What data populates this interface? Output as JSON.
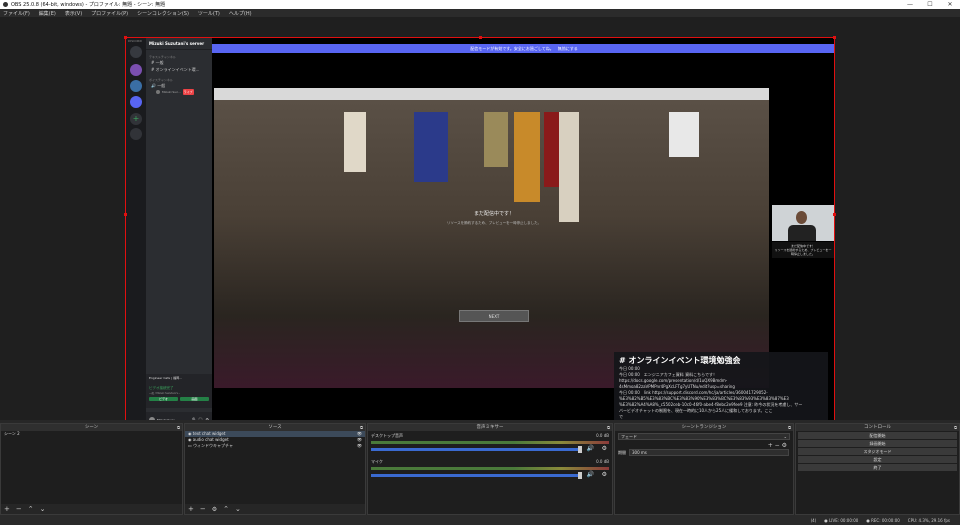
{
  "titlebar": {
    "title": "OBS 25.0.8 (64-bit, windows) - プロファイル: 無題 - シーン: 無題",
    "minimize": "—",
    "maximize": "☐",
    "close": "✕"
  },
  "menu": [
    "ファイル(F)",
    "編集(E)",
    "表示(V)",
    "プロファイル(P)",
    "シーンコレクション(S)",
    "ツール(T)",
    "ヘルプ(H)"
  ],
  "discord": {
    "app_label": "DISCORD",
    "server_name": "Mizuki Suzutani's server",
    "text_category": "テキストチャンネル",
    "text_channels": [
      "一般",
      "オンラインイベント環..."
    ],
    "voice_category": "ボイスチャンネル",
    "voice_channels": [
      "一般"
    ],
    "voice_user": "Mizuki Suz...",
    "live_badge": "ライブ",
    "notice": "配信モードが有効です。安全にお過ごしてね。　無効にする",
    "stream_card_title": "Engineer Cafe | 福岡...",
    "stream_card_status": "ビデオ接続完了",
    "stream_card_sub": "一般 / Mizuki Suzutani's...",
    "btn_video": "ビデオ",
    "btn_screen": "画面",
    "user_name": "Mizuki Suzu...",
    "user_tag": "#0000"
  },
  "stream": {
    "center_title": "まだ配信中です！",
    "center_sub": "リソースを節約するため、プレビューを一時停止しました。",
    "next_button": "NEXT",
    "webcam_title": "まだ配信中です！",
    "webcam_sub": "リソースを節約するため、プレビューを一時停止しました。"
  },
  "chat": {
    "title": "オンラインイベント環境勉強会",
    "lines": [
      "今日 00:00",
      "今日 00:00　エンジニアカフェ資料 資料こちらです！",
      "https://docs.google.com/presentation/d/1uQX9Bmdm-",
      "4sMmoa82zaVPMPnr4PgXcLFTg7yUTNu/edit?usp=sharing",
      "今日 00:00　link https://support.discord.com/hc/ja/articles/360041729052-",
      "%E3%82%B5%E3%83%BC%E3%83%90%E3%83%BC%E3%83%93%E3%83%87%E3",
      "%E3%82%A4%A8%_c5502ceb-10c0-46f0-abe4-f8ebc2e9fee9 注意: 昨今の状況を考慮し、サー",
      "バービデオチャットの制限を、現在一時的に10人から25人に緩和しております。ここ",
      "で"
    ]
  },
  "docks": {
    "scenes": {
      "title": "シーン",
      "items": [
        "シーン 2"
      ]
    },
    "sources": {
      "title": "ソース",
      "items": [
        "text chat widget",
        "audio chat widget",
        "ウィンドウキャプチャ"
      ]
    },
    "mixer": {
      "title": "音声ミキサー",
      "tracks": [
        {
          "name": "デスクトップ音声",
          "db": "0.0 dB"
        },
        {
          "name": "マイク",
          "db": "0.0 dB"
        }
      ]
    },
    "transitions": {
      "title": "シーントランジション",
      "type": "フェード",
      "duration_label": "期間",
      "duration_value": "300 ms"
    },
    "controls": {
      "title": "コントロール",
      "buttons": [
        "配信開始",
        "録画開始",
        "スタジオモード",
        "設定",
        "終了"
      ]
    }
  },
  "status": {
    "drops": "(4)",
    "live": "LIVE: 00:00:00",
    "rec": "REC: 00:00:00",
    "cpu": "CPU: 4.3%, 29.16 fps"
  },
  "colors": {
    "accent": "#e01010",
    "discord_blurple": "#5865f2",
    "obs_bg": "#1e1e1e"
  }
}
